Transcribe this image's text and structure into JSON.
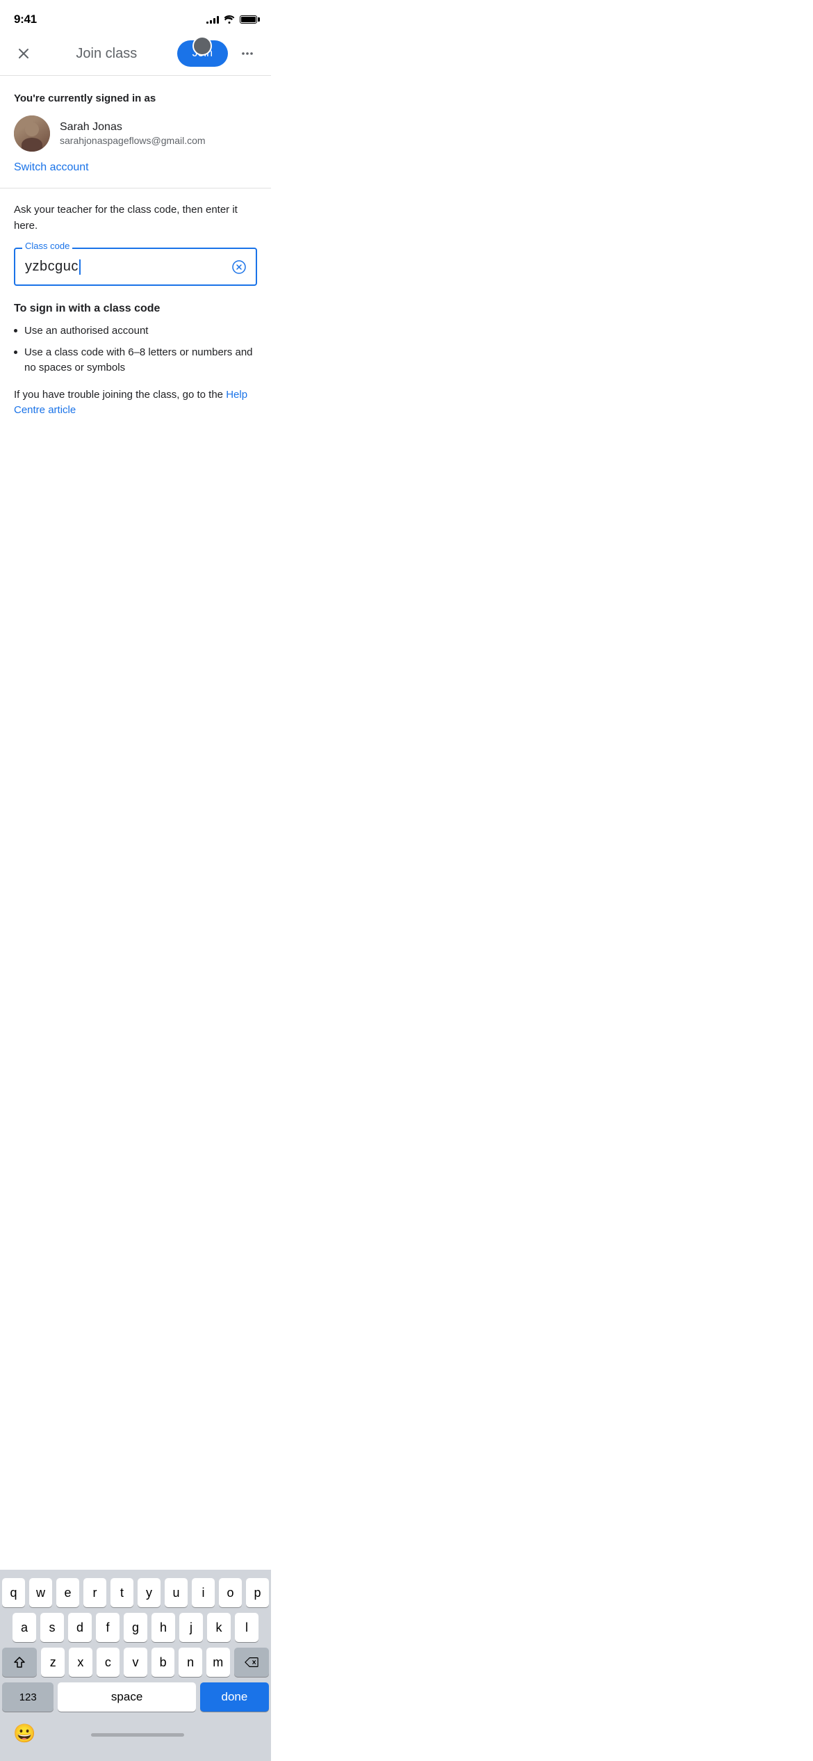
{
  "status": {
    "time": "9:41",
    "signal": [
      3,
      5,
      7,
      9,
      11
    ],
    "wifi": "wifi",
    "battery": 90
  },
  "nav": {
    "close_label": "×",
    "title": "Join class",
    "join_label": "Join",
    "more_label": "•••"
  },
  "account": {
    "signed_in_label": "You're currently signed in as",
    "name": "Sarah Jonas",
    "email": "sarahjonaspageflows@gmail.com",
    "switch_label": "Switch account"
  },
  "body": {
    "instruction": "Ask your teacher for the class code, then enter it here.",
    "input_label": "Class code",
    "input_value": "yzbcguc",
    "sign_in_title": "To sign in with a class code",
    "bullets": [
      "Use an authorised account",
      "Use a class code with 6–8 letters or numbers and no spaces or symbols"
    ],
    "help_text": "If you have trouble joining the class, go to the",
    "help_link": "Help Centre article"
  },
  "keyboard": {
    "row1": [
      "q",
      "w",
      "e",
      "r",
      "t",
      "y",
      "u",
      "i",
      "o",
      "p"
    ],
    "row2": [
      "a",
      "s",
      "d",
      "f",
      "g",
      "h",
      "j",
      "k",
      "l"
    ],
    "row3": [
      "z",
      "x",
      "c",
      "v",
      "b",
      "n",
      "m"
    ],
    "num_label": "123",
    "space_label": "space",
    "done_label": "done"
  }
}
